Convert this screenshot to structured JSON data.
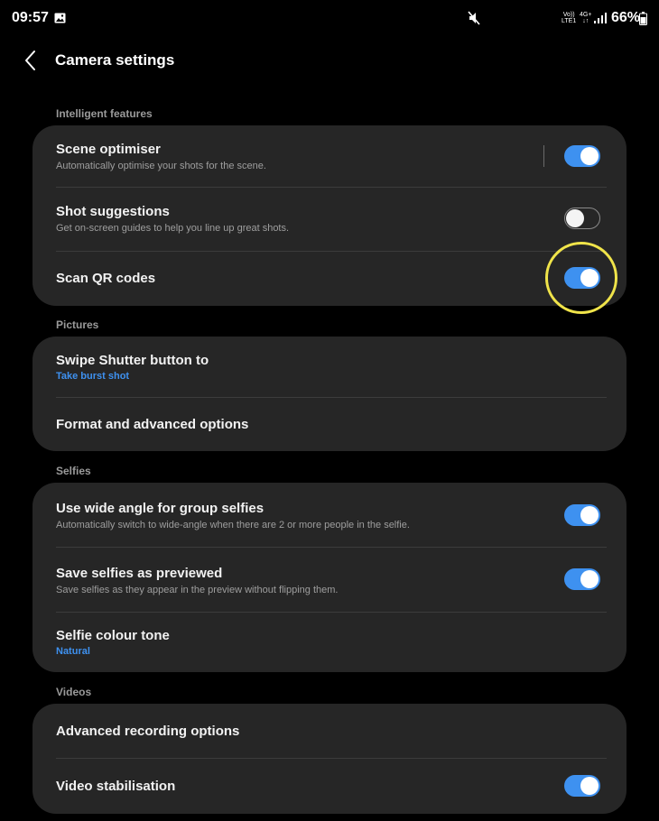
{
  "status_bar": {
    "time": "09:57",
    "volte_line1": "Vo))",
    "volte_line2": "LTE1",
    "network_line1": "4G+",
    "network_line2": "↓↑",
    "battery": "66%"
  },
  "header": {
    "title": "Camera settings"
  },
  "sections": {
    "intelligent": {
      "header": "Intelligent features",
      "scene_optimiser": {
        "title": "Scene optimiser",
        "subtitle": "Automatically optimise your shots for the scene.",
        "enabled": true
      },
      "shot_suggestions": {
        "title": "Shot suggestions",
        "subtitle": "Get on-screen guides to help you line up great shots.",
        "enabled": false
      },
      "scan_qr": {
        "title": "Scan QR codes",
        "enabled": true
      }
    },
    "pictures": {
      "header": "Pictures",
      "swipe_shutter": {
        "title": "Swipe Shutter button to",
        "value": "Take burst shot"
      },
      "format_options": {
        "title": "Format and advanced options"
      }
    },
    "selfies": {
      "header": "Selfies",
      "wide_angle": {
        "title": "Use wide angle for group selfies",
        "subtitle": "Automatically switch to wide-angle when there are 2 or more people in the selfie.",
        "enabled": true
      },
      "save_previewed": {
        "title": "Save selfies as previewed",
        "subtitle": "Save selfies as they appear in the preview without flipping them.",
        "enabled": true
      },
      "colour_tone": {
        "title": "Selfie colour tone",
        "value": "Natural"
      }
    },
    "videos": {
      "header": "Videos",
      "advanced_recording": {
        "title": "Advanced recording options"
      },
      "video_stabilisation": {
        "title": "Video stabilisation",
        "enabled": true
      }
    }
  },
  "colors": {
    "accent": "#3e91f0",
    "card_background": "#262626",
    "highlight": "#f0e44a"
  },
  "icons": {
    "back": "chevron-left-icon",
    "gallery": "image-icon",
    "mute": "mute-icon",
    "signal": "signal-bars-icon",
    "battery": "battery-icon"
  }
}
